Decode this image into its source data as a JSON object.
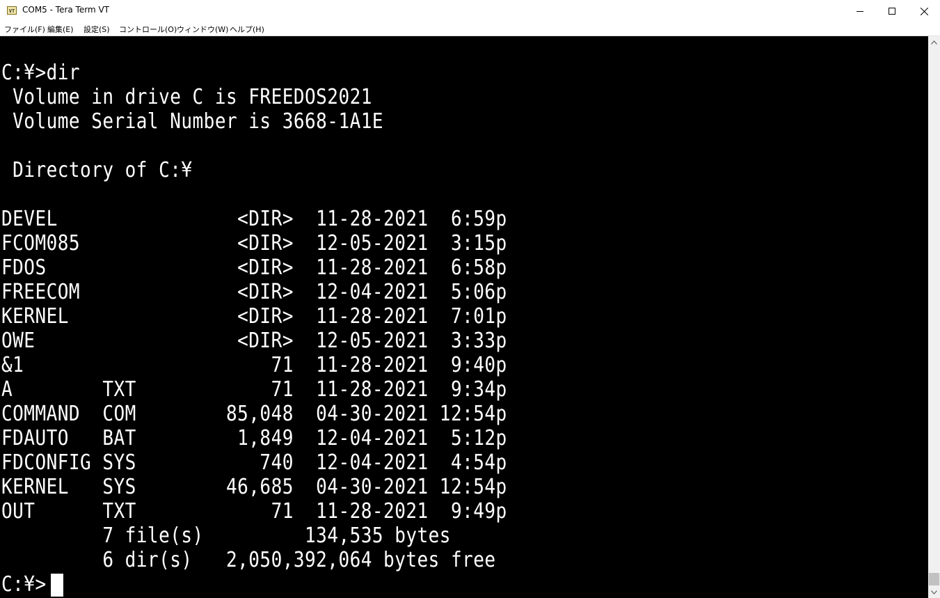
{
  "window": {
    "title": "COM5 - Tera Term VT",
    "icon_label": "VT"
  },
  "menu": [
    "ファイル(F)",
    "編集(E)",
    "設定(S)",
    "コントロール(O)",
    "ウィンドウ(W)",
    "ヘルプ(H)"
  ],
  "terminal": {
    "lines": [
      "",
      "C:¥>dir",
      " Volume in drive C is FREEDOS2021",
      " Volume Serial Number is 3668-1A1E",
      "",
      " Directory of C:¥",
      "",
      "DEVEL                <DIR>  11-28-2021  6:59p",
      "FCOM085              <DIR>  12-05-2021  3:15p",
      "FDOS                 <DIR>  11-28-2021  6:58p",
      "FREECOM              <DIR>  12-04-2021  5:06p",
      "KERNEL               <DIR>  11-28-2021  7:01p",
      "OWE                  <DIR>  12-05-2021  3:33p",
      "&1                      71  11-28-2021  9:40p",
      "A        TXT            71  11-28-2021  9:34p",
      "COMMAND  COM        85,048  04-30-2021 12:54p",
      "FDAUTO   BAT         1,849  12-04-2021  5:12p",
      "FDCONFIG SYS           740  12-04-2021  4:54p",
      "KERNEL   SYS        46,685  04-30-2021 12:54p",
      "OUT      TXT            71  11-28-2021  9:49p",
      "         7 file(s)         134,535 bytes",
      "         6 dir(s)   2,050,392,064 bytes free",
      "C:¥>"
    ]
  },
  "colors": {
    "terminal_bg": "#000000",
    "terminal_fg": "#ffffff"
  }
}
